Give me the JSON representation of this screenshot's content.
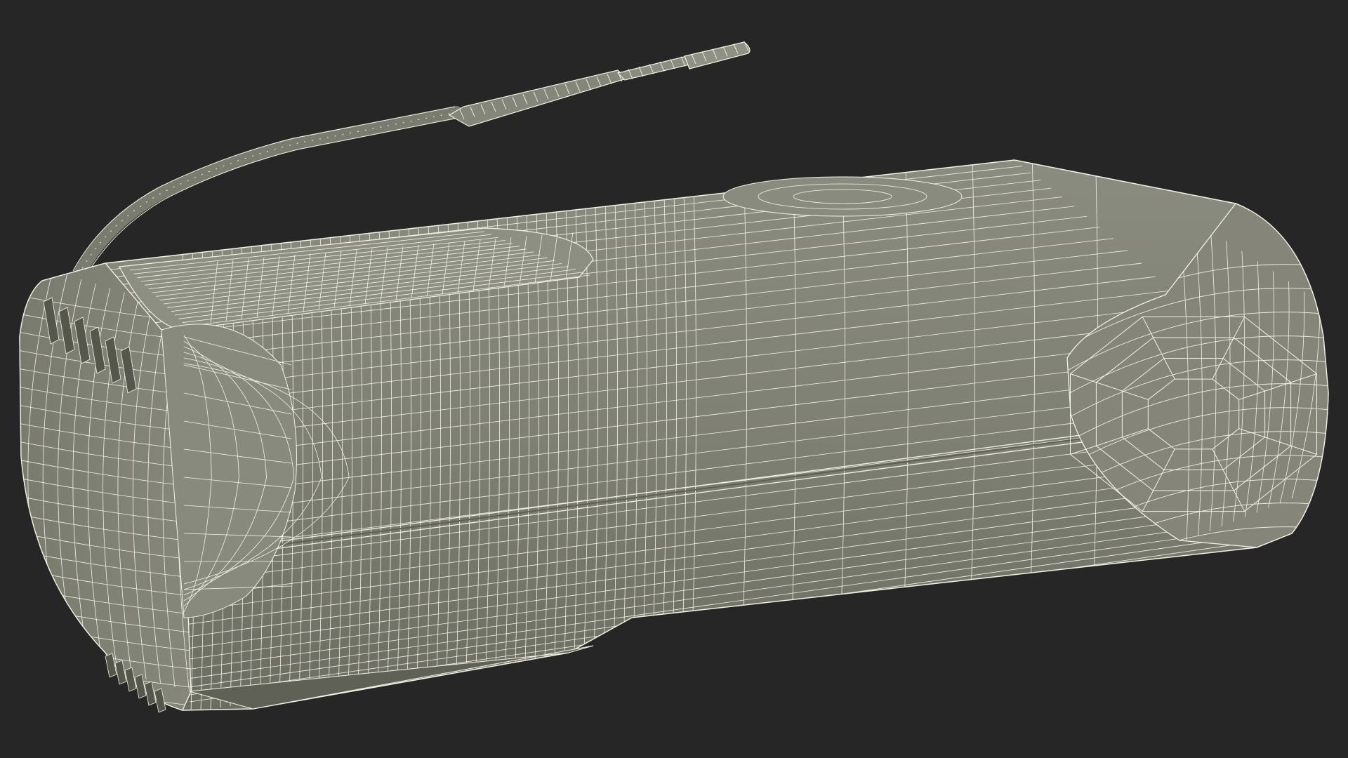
{
  "colors": {
    "background": "#262626",
    "surface_light": "#8b8c80",
    "surface_mid": "#7e7f73",
    "surface_dark": "#6c6d62",
    "wire": "#f4f3e6"
  }
}
